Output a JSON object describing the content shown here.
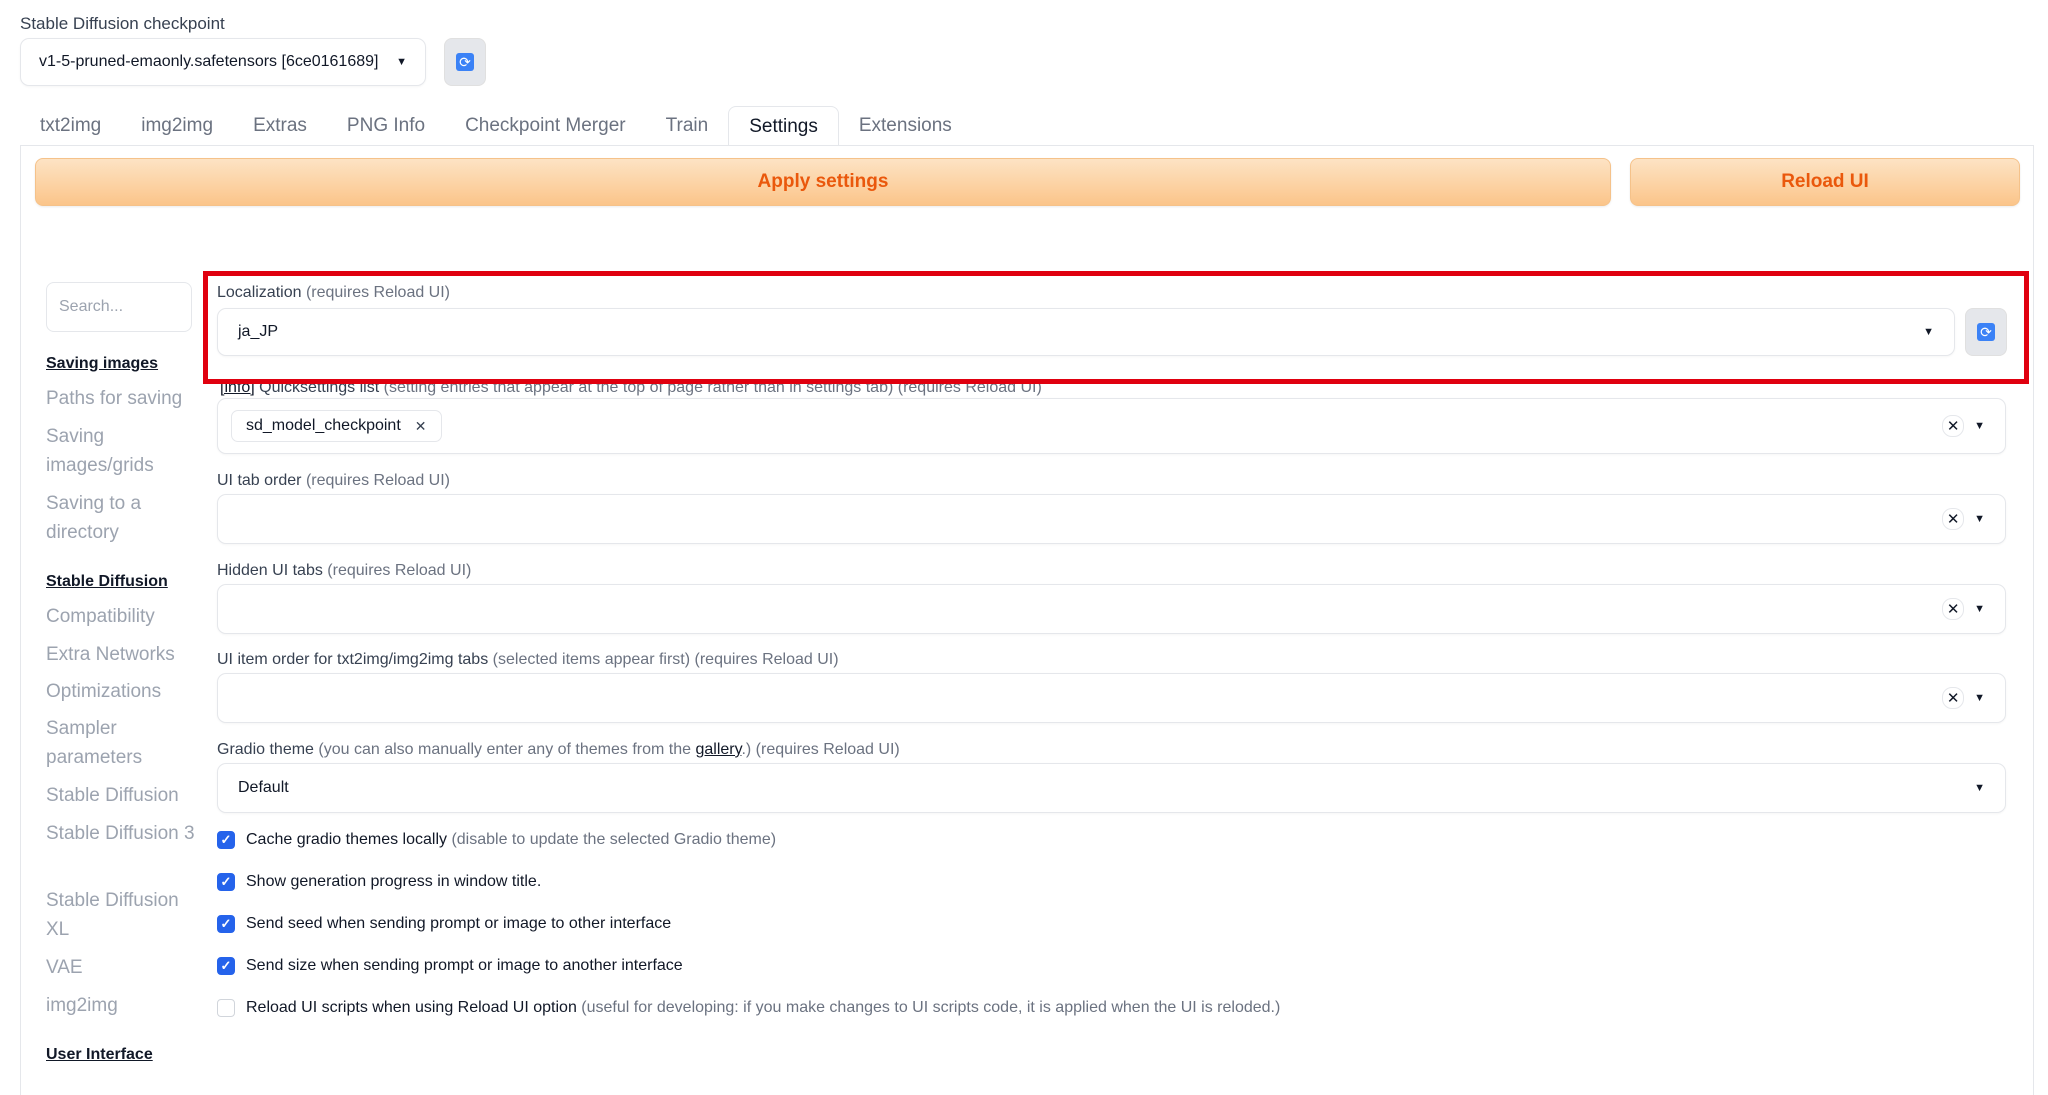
{
  "checkpoint": {
    "label": "Stable Diffusion checkpoint",
    "value": "v1-5-pruned-emaonly.safetensors [6ce0161689]"
  },
  "tabs": [
    {
      "label": "txt2img"
    },
    {
      "label": "img2img"
    },
    {
      "label": "Extras"
    },
    {
      "label": "PNG Info"
    },
    {
      "label": "Checkpoint Merger"
    },
    {
      "label": "Train"
    },
    {
      "label": "Settings",
      "active": true
    },
    {
      "label": "Extensions"
    }
  ],
  "toolbar": {
    "apply_label": "Apply settings",
    "reload_label": "Reload UI"
  },
  "search": {
    "placeholder": "Search..."
  },
  "sidebar": {
    "items": [
      {
        "label": "Saving images",
        "section": true
      },
      {
        "label": "Paths for saving"
      },
      {
        "label": "Saving images/grids"
      },
      {
        "label": "Saving to a directory"
      },
      {
        "label": "Stable Diffusion",
        "section": true
      },
      {
        "label": "Compatibility"
      },
      {
        "label": "Extra Networks"
      },
      {
        "label": "Optimizations"
      },
      {
        "label": "Sampler parameters"
      },
      {
        "label": "Stable Diffusion"
      },
      {
        "label": "Stable Diffusion 3"
      },
      {
        "label": "Stable Diffusion XL"
      },
      {
        "label": "VAE"
      },
      {
        "label": "img2img"
      },
      {
        "label": "User Interface",
        "section": true
      }
    ]
  },
  "settings": {
    "localization": {
      "label": "Localization",
      "note": "(requires Reload UI)",
      "value": "ja_JP"
    },
    "quicksettings": {
      "info": "[info]",
      "label": "Quicksettings list",
      "note": "(setting entries that appear at the top of page rather than in settings tab) (requires Reload UI)",
      "chip": "sd_model_checkpoint"
    },
    "tab_order": {
      "label": "UI tab order",
      "note": "(requires Reload UI)"
    },
    "hidden_tabs": {
      "label": "Hidden UI tabs",
      "note": "(requires Reload UI)"
    },
    "item_order": {
      "label": "UI item order for txt2img/img2img tabs",
      "note": "(selected items appear first) (requires Reload UI)"
    },
    "gradio_theme": {
      "label": "Gradio theme",
      "note_pre": "(you can also manually enter any of themes from the",
      "link": "gallery",
      "note_post": ".) (requires Reload UI)",
      "value": "Default"
    },
    "checks": [
      {
        "label": "Cache gradio themes locally",
        "note": "(disable to update the selected Gradio theme)",
        "checked": true
      },
      {
        "label": "Show generation progress in window title.",
        "note": "",
        "checked": true
      },
      {
        "label": "Send seed when sending prompt or image to other interface",
        "note": "",
        "checked": true
      },
      {
        "label": "Send size when sending prompt or image to another interface",
        "note": "",
        "checked": true
      },
      {
        "label": "Reload UI scripts when using Reload UI option",
        "note": "(useful for developing: if you make changes to UI scripts code, it is applied when the UI is reloded.)",
        "checked": false
      }
    ]
  },
  "colors": {
    "accent_orange": "#ea580c",
    "highlight_red": "#e0000f",
    "checkbox_blue": "#2563eb",
    "refresh_blue": "#3b82f6"
  },
  "icons": [
    "refresh-icon",
    "caret-down-icon",
    "clear-icon",
    "checkmark-icon",
    "chip-remove-icon"
  ]
}
